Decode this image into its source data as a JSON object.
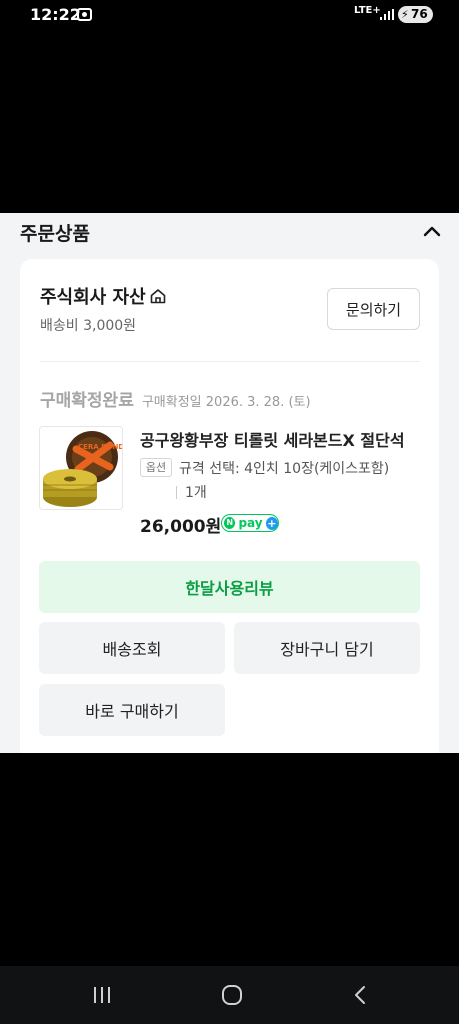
{
  "status_bar": {
    "time": "12:22",
    "network": "LTE+",
    "battery": "76",
    "icons": [
      "screen-record-icon",
      "signal-icon",
      "battery-charging-icon"
    ]
  },
  "section": {
    "title": "주문상품",
    "toggle_icon": "chevron-up-icon"
  },
  "seller": {
    "name": "주식회사 자산",
    "store_icon": "home-icon",
    "shipping_fee": "배송비 3,000원",
    "inquiry_label": "문의하기"
  },
  "order": {
    "status": "구매확정완료",
    "confirm_date": "구매확정일 2026. 3. 28. (토)"
  },
  "product": {
    "name": "공구왕황부장 티롤릿 세라본드X 절단석",
    "option_badge": "옵션",
    "option_text": "규격 선택: 4인치 10장(케이스포함)",
    "quantity": "1개",
    "price": "26,000원",
    "pay_badge": {
      "logo_letter": "N",
      "text": "pay",
      "plus": "+"
    },
    "thumb_label": "CERA BOND"
  },
  "actions": {
    "review": "한달사용리뷰",
    "track": "배송조회",
    "cart": "장바구니 담기",
    "buy_again": "바로 구매하기"
  },
  "colors": {
    "review_bg": "#e4f9ea",
    "review_text": "#0b9d45",
    "npay_green": "#03c75a",
    "npay_plus_blue": "#1e9cf0"
  },
  "nav_bar": {
    "icons": [
      "recents-icon",
      "home-icon",
      "back-icon"
    ]
  }
}
